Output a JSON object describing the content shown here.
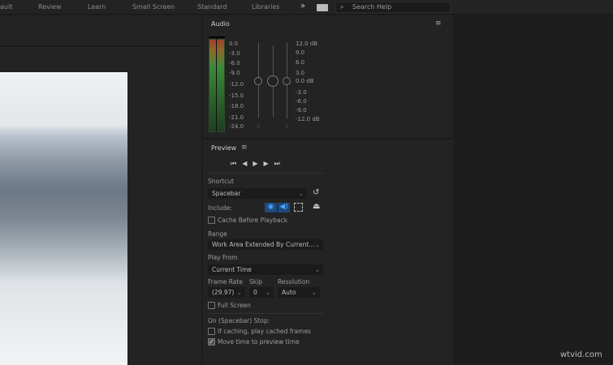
{
  "topbar": {
    "workspaces": [
      "ault",
      "Review",
      "Learn",
      "Small Screen",
      "Standard",
      "Libraries"
    ],
    "overflow": "»",
    "search_placeholder": "Search Help"
  },
  "audio": {
    "title": "Audio",
    "left_scale": [
      "0.0",
      "-3.0",
      "-6.0",
      "-9.0",
      "-12.0",
      "-15.0",
      "-18.0",
      "-21.0",
      "-24.0"
    ],
    "right_scale": [
      "12.0 dB",
      "9.0",
      "6.0",
      "3.0",
      "0.0 dB",
      "-3.0",
      "-6.0",
      "-9.0",
      "-12.0 dB"
    ],
    "left_value": "0",
    "right_value": "0"
  },
  "preview": {
    "title": "Preview",
    "shortcut_label": "Shortcut",
    "shortcut_value": "Spacebar",
    "include_label": "Include:",
    "cache_label": "Cache Before Playback",
    "cache_checked": false,
    "range_label": "Range",
    "range_value": "Work Area Extended By Current...",
    "play_from_label": "Play From",
    "play_from_value": "Current Time",
    "frame_rate_label": "Frame Rate",
    "frame_rate_value": "(29.97)",
    "skip_label": "Skip",
    "skip_value": "0",
    "resolution_label": "Resolution",
    "resolution_value": "Auto",
    "full_screen_label": "Full Screen",
    "full_screen_checked": false,
    "stop_label": "On (Spacebar) Stop:",
    "if_caching_label": "If caching, play cached frames",
    "if_caching_checked": false,
    "move_time_label": "Move time to preview time",
    "move_time_checked": true,
    "accent": "#2d8ceb"
  },
  "watermark": "wtvid.com"
}
